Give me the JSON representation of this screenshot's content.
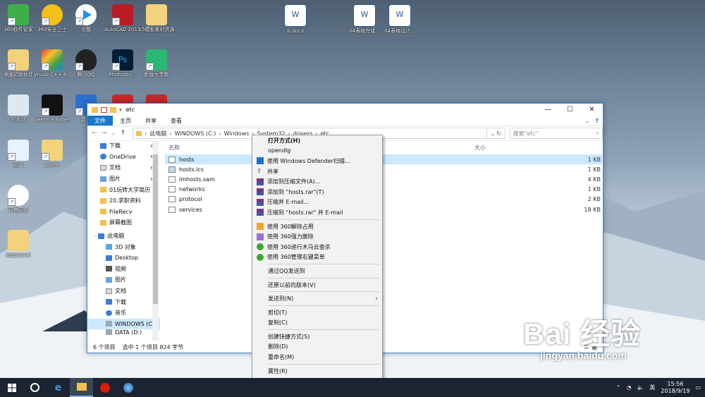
{
  "desktop": {
    "icons": [
      {
        "label": "360软件管家"
      },
      {
        "label": "360安全卫士"
      },
      {
        "label": "优酷"
      },
      {
        "label": "AutoCAD 2011 - S..."
      },
      {
        "label": "15模板素材资源"
      },
      {
        "label": "电脑初始软件"
      },
      {
        "label": "Visual C++ 6.0"
      },
      {
        "label": "腾讯QQ"
      },
      {
        "label": "Photosho..."
      },
      {
        "label": "新版大学数"
      },
      {
        "label": "回收站"
      },
      {
        "label": "GeForce Experience"
      },
      {
        "label": "数学"
      },
      {
        "label": "迅雷"
      },
      {
        "label": "pkpm"
      },
      {
        "label": "百度网盘"
      },
      {
        "label": "新建文件夹"
      },
      {
        "label": "&.docx"
      },
      {
        "label": "04表格完成..."
      },
      {
        "label": "04表格设计..."
      }
    ]
  },
  "explorer": {
    "title": "etc",
    "ribbon_tabs": [
      "文件",
      "主页",
      "共享",
      "查看"
    ],
    "address": [
      "此电脑",
      "WINDOWS (C:)",
      "Windows",
      "System32",
      "drivers",
      "etc"
    ],
    "search_placeholder": "搜索\"etc\"",
    "columns": {
      "name": "名称",
      "size": "大小"
    },
    "nav_tree": [
      {
        "label": "下载",
        "pinned": true
      },
      {
        "label": "OneDrive",
        "pinned": true
      },
      {
        "label": "文档",
        "pinned": true
      },
      {
        "label": "图片",
        "pinned": true
      },
      {
        "label": "01玩转大学简历"
      },
      {
        "label": "20.求职资料"
      },
      {
        "label": "FileRecv"
      },
      {
        "label": "屏幕截图"
      },
      {
        "label": "此电脑"
      },
      {
        "label": "3D 对象"
      },
      {
        "label": "Desktop"
      },
      {
        "label": "视频"
      },
      {
        "label": "图片"
      },
      {
        "label": "文档"
      },
      {
        "label": "下载"
      },
      {
        "label": "音乐"
      },
      {
        "label": "WINDOWS (C:)"
      },
      {
        "label": "DATA (D:)"
      }
    ],
    "files": [
      {
        "name": "hosts",
        "size": "1 KB"
      },
      {
        "name": "hosts.ics",
        "size": "1 KB"
      },
      {
        "name": "lmhosts.sam",
        "size": "4 KB"
      },
      {
        "name": "networks",
        "size": "1 KB"
      },
      {
        "name": "protocol",
        "size": "2 KB"
      },
      {
        "name": "services",
        "size": "18 KB"
      }
    ],
    "status": {
      "count": "6 个项目",
      "selected": "选中 1 个项目  824 字节"
    }
  },
  "context_menu": {
    "items": [
      {
        "label": "打开方式(H)",
        "bold": true
      },
      {
        "label": "opendlg"
      },
      {
        "label": "使用 Windows Defender扫描..."
      },
      {
        "label": "共享"
      },
      {
        "label": "添加到压缩文件(A)..."
      },
      {
        "label": "添加到 \"hosts.rar\"(T)"
      },
      {
        "label": "压缩并 E-mail..."
      },
      {
        "label": "压缩到 \"hosts.rar\" 并 E-mail"
      },
      {
        "label": "使用 360解除占用"
      },
      {
        "label": "使用 360强力删除"
      },
      {
        "label": "使用 360进行木马云查杀"
      },
      {
        "label": "使用 360管理右键菜单"
      },
      {
        "label": "通过QQ发送到"
      },
      {
        "label": "还原以前的版本(V)"
      },
      {
        "label": "发送到(N)"
      },
      {
        "label": "剪切(T)"
      },
      {
        "label": "复制(C)"
      },
      {
        "label": "创建快捷方式(S)"
      },
      {
        "label": "删除(D)"
      },
      {
        "label": "重命名(M)"
      },
      {
        "label": "属性(R)"
      }
    ]
  },
  "taskbar": {
    "time": "15:56",
    "date": "2018/9/19",
    "ime": "英"
  },
  "watermark": {
    "main": "Bai 经验",
    "url": "jingyan.baidu.com"
  },
  "colors": {
    "accent": "#1979ca",
    "selection": "#cce8ff",
    "taskbar": "#1b2430"
  }
}
